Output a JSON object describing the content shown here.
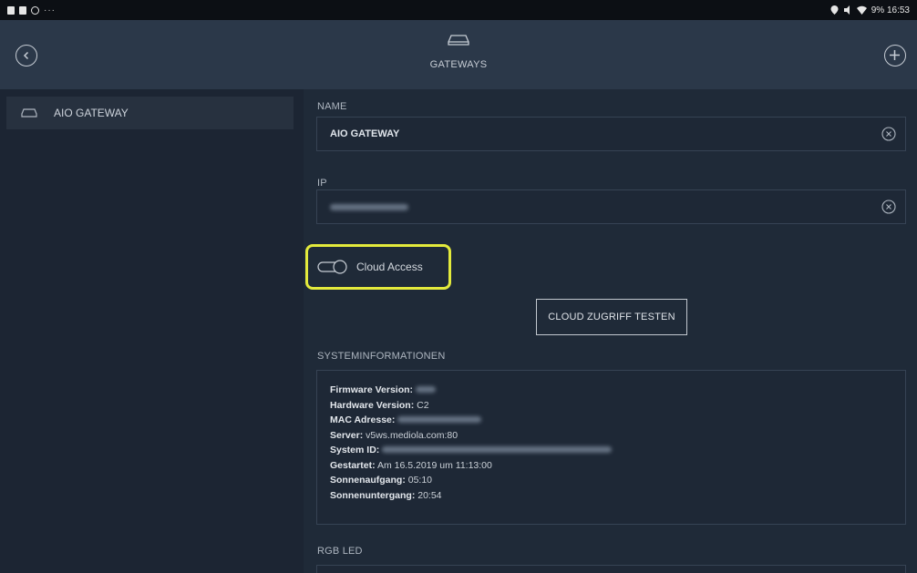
{
  "statusbar": {
    "left_dots": "···",
    "right_text": "9% 16:53"
  },
  "header": {
    "title": "GATEWAYS",
    "back_icon": "back-circle-icon",
    "add_icon": "plus-circle-icon",
    "gateway_icon": "gateway-icon"
  },
  "sidebar": {
    "items": [
      {
        "label": "AIO GATEWAY",
        "icon": "gateway-icon"
      }
    ]
  },
  "form": {
    "name_label": "NAME",
    "name_value": "AIO GATEWAY",
    "ip_label": "IP",
    "ip_value": "",
    "cloud_access_label": "Cloud Access",
    "cloud_access_enabled": false,
    "test_button_label": "CLOUD ZUGRIFF TESTEN",
    "highlight_color": "#e3ea3c"
  },
  "system_info": {
    "section_label": "SYSTEMINFORMATIONEN",
    "rows": [
      {
        "key": "Firmware Version:",
        "value": ""
      },
      {
        "key": "Hardware Version:",
        "value": "C2"
      },
      {
        "key": "MAC Adresse:",
        "value": ""
      },
      {
        "key": "Server:",
        "value": "v5ws.mediola.com:80"
      },
      {
        "key": "System ID:",
        "value": ""
      },
      {
        "key": "Gestartet:",
        "value": "Am 16.5.2019 um 11:13:00"
      },
      {
        "key": "Sonnenaufgang:",
        "value": "05:10"
      },
      {
        "key": "Sonnenuntergang:",
        "value": "20:54"
      }
    ]
  },
  "rgb_led": {
    "section_label": "RGB LED"
  }
}
